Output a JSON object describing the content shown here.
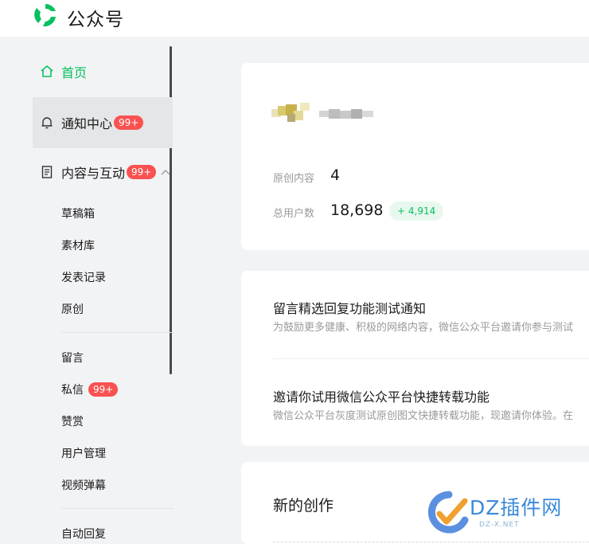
{
  "header": {
    "brand": "公众号",
    "logo_icon": "wechat-official-account-logo",
    "accent": "#07c160"
  },
  "sidebar": {
    "home": {
      "label": "首页",
      "icon": "home-icon"
    },
    "notifications": {
      "label": "通知中心",
      "badge": "99+",
      "icon": "bell-icon"
    },
    "content": {
      "label": "内容与互动",
      "badge": "99+",
      "icon": "document-icon",
      "expanded": true
    },
    "sub_items": [
      {
        "label": "草稿箱"
      },
      {
        "label": "素材库"
      },
      {
        "label": "发表记录"
      },
      {
        "label": "原创"
      },
      {
        "label": "留言"
      },
      {
        "label": "私信",
        "badge": "99+"
      },
      {
        "label": "赞赏"
      },
      {
        "label": "用户管理"
      },
      {
        "label": "视频弹幕"
      },
      {
        "label": "自动回复"
      }
    ]
  },
  "account": {
    "original_label": "原创内容",
    "original_value": "4",
    "users_label": "总用户数",
    "users_value": "18,698",
    "users_growth": "+ 4,914"
  },
  "notices": [
    {
      "title": "留言精选回复功能测试通知",
      "desc": "为鼓励更多健康、积极的网络内容，微信公众平台邀请你参与测试"
    },
    {
      "title": "邀请你试用微信公众平台快捷转载功能",
      "desc": "微信公众平台灰度测试原创图文快捷转载功能，现邀请你体验。在"
    }
  ],
  "creation": {
    "title": "新的创作"
  },
  "watermark": {
    "text": "DZ插件网",
    "sub": "DZ-X.NET"
  }
}
